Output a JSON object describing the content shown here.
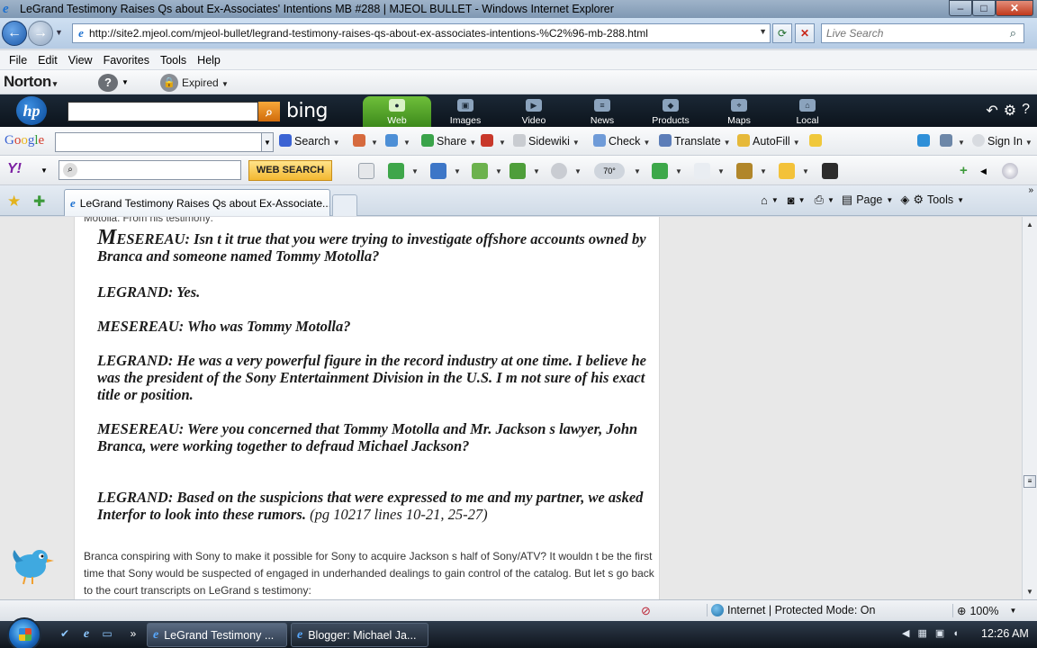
{
  "window": {
    "title": "LeGrand Testimony Raises Qs about Ex-Associates' Intentions  MB #288 | MJEOL BULLET - Windows Internet Explorer",
    "controls": {
      "minimize": "–",
      "maximize": "□",
      "close": "✕"
    }
  },
  "address_bar": {
    "url": "http://site2.mjeol.com/mjeol-bullet/legrand-testimony-raises-qs-about-ex-associates-intentions-%C2%96-mb-288.html",
    "search_placeholder": "Live Search"
  },
  "menu": {
    "items": [
      "File",
      "Edit",
      "View",
      "Favorites",
      "Tools",
      "Help"
    ]
  },
  "norton": {
    "logo": "Norton",
    "status": "Expired"
  },
  "bing": {
    "logo": "bing",
    "tabs": [
      "Web",
      "Images",
      "Video",
      "News",
      "Products",
      "Maps",
      "Local"
    ],
    "active_tab": "Web"
  },
  "google": {
    "logo": [
      "G",
      "o",
      "o",
      "g",
      "l",
      "e"
    ],
    "items": [
      "Search",
      "Share",
      "Sidewiki",
      "Check",
      "Translate",
      "AutoFill",
      "Sign In"
    ]
  },
  "yahoo": {
    "logo": "Y!",
    "search_button": "WEB SEARCH",
    "weather": "70°"
  },
  "tabs": {
    "active_title": "LeGrand Testimony Raises Qs about Ex-Associate...",
    "commands": {
      "page": "Page",
      "tools": "Tools"
    }
  },
  "article": {
    "cut_top": "Motolla. From his testimony:",
    "quotes": [
      {
        "first_letter": "M",
        "text": "ESEREAU: Isn   t it true that you were trying to investigate offshore accounts owned by Branca and someone named Tommy Motolla?"
      },
      {
        "text": "LEGRAND: Yes."
      },
      {
        "text": "MESEREAU: Who was Tommy Motolla?"
      },
      {
        "text": "LEGRAND: He was a very powerful figure in the record industry at one time. I believe he was the president of the Sony Entertainment Division in the U.S. I   m not sure of his exact title or position."
      },
      {
        "text": "MESEREAU: Were you concerned that Tommy Motolla and Mr. Jackson   s lawyer, John Branca, were working together to defraud Michael Jackson?"
      },
      {
        "text": "LEGRAND: Based on the suspicions that were expressed to me and my partner, we asked Interfor to look into these rumors.",
        "citation": " (pg 10217 lines 10-21, 25-27)"
      }
    ],
    "body": "Branca conspiring with Sony to make it possible for Sony to acquire Jackson   s half of Sony/ATV? It wouldn   t be the first time that Sony would be suspected of engaged in underhanded dealings to gain control of the catalog. But let   s go back to the court transcripts on LeGrand   s testimony:"
  },
  "status": {
    "zone": "Internet | Protected Mode: On",
    "zoom": "100%"
  },
  "taskbar": {
    "tasks": [
      "LeGrand Testimony ...",
      "Blogger: Michael Ja..."
    ],
    "clock": "12:26 AM"
  },
  "colors": {
    "accent": "#1c58a8",
    "bing_active": "#3d8a1c",
    "yahoo_button": "#f3b831"
  }
}
